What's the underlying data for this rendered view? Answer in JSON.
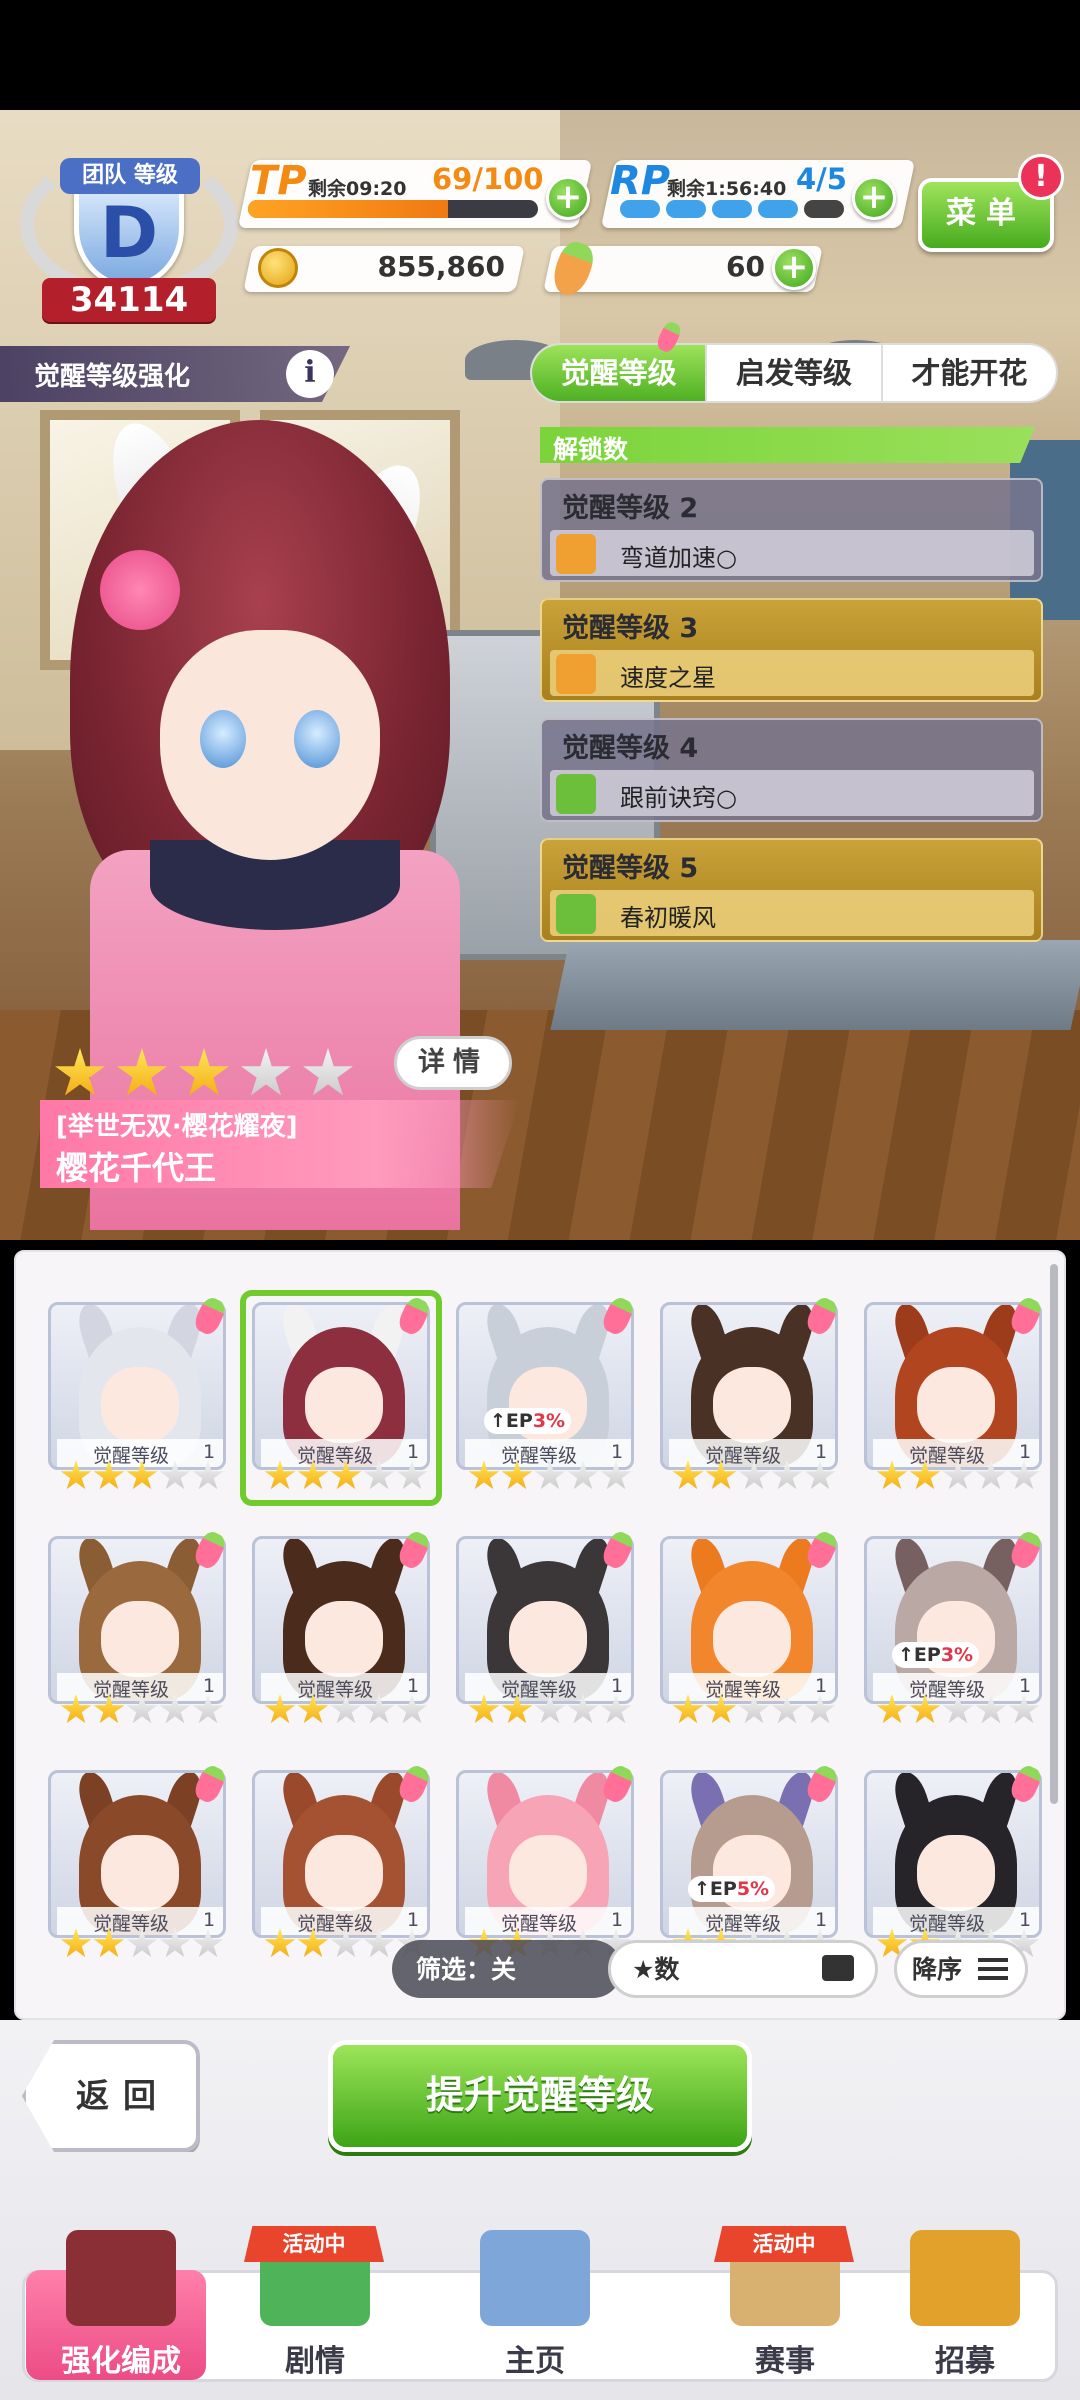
{
  "hud": {
    "team_rank_title": "团队 等级",
    "team_rank_letter": "D",
    "team_score": "34114",
    "tp": {
      "label": "TP",
      "remain": "剩余09:20",
      "value": "69/100",
      "fill": 0.69
    },
    "rp": {
      "label": "RP",
      "remain": "剩余1:56:40",
      "value": "4/5",
      "filled_pips": 4,
      "total_pips": 5
    },
    "money": "855,860",
    "carrots": "60",
    "plus": "+",
    "menu_label": "菜单",
    "menu_alert": "!"
  },
  "section": {
    "title": "觉醒等级强化",
    "info": "i"
  },
  "tabs": [
    {
      "label": "觉醒等级",
      "active": true
    },
    {
      "label": "启发等级",
      "active": false
    },
    {
      "label": "才能开花",
      "active": false
    }
  ],
  "unlock": {
    "header": "解锁数",
    "items": [
      {
        "level": "觉醒等级 2",
        "skill": "弯道加速○",
        "unlocked": false,
        "icon_color": "#f0a030"
      },
      {
        "level": "觉醒等级 3",
        "skill": "速度之星",
        "unlocked": true,
        "icon_color": "#f0a030"
      },
      {
        "level": "觉醒等级 4",
        "skill": "跟前诀窍○",
        "unlocked": false,
        "icon_color": "#6bbf3a"
      },
      {
        "level": "觉醒等级 5",
        "skill": "春初暖风",
        "unlocked": true,
        "icon_color": "#6bbf3a"
      }
    ]
  },
  "character": {
    "stars": 3,
    "max_stars": 5,
    "detail_label": "详情",
    "title": "[举世无双·樱花耀夜]",
    "name": "樱花千代王"
  },
  "roster": {
    "lv_label": "觉醒等级",
    "cards": [
      {
        "hair": "#e4e6ee",
        "ear": "#d3d6e0",
        "stars": 3,
        "lv": "1",
        "ep": "",
        "selected": false
      },
      {
        "hair": "#8d2f3f",
        "ear": "#f2f2f2",
        "stars": 3,
        "lv": "1",
        "ep": "",
        "selected": true
      },
      {
        "hair": "#c9cfd9",
        "ear": "#c9cfd9",
        "stars": 2,
        "lv": "1",
        "ep": "3%",
        "selected": false
      },
      {
        "hair": "#4a3126",
        "ear": "#4a3126",
        "stars": 2,
        "lv": "1",
        "ep": "",
        "selected": false
      },
      {
        "hair": "#b0451f",
        "ear": "#9c3c1b",
        "stars": 2,
        "lv": "1",
        "ep": "",
        "selected": false
      },
      {
        "hair": "#9a6a3e",
        "ear": "#8b5d34",
        "stars": 2,
        "lv": "1",
        "ep": "",
        "selected": false
      },
      {
        "hair": "#4a2b1c",
        "ear": "#4a2b1c",
        "stars": 2,
        "lv": "1",
        "ep": "",
        "selected": false
      },
      {
        "hair": "#3b3638",
        "ear": "#3b3638",
        "stars": 2,
        "lv": "1",
        "ep": "",
        "selected": false
      },
      {
        "hair": "#f2862c",
        "ear": "#ec7a1e",
        "stars": 2,
        "lv": "1",
        "ep": "",
        "selected": false
      },
      {
        "hair": "#b9a8a4",
        "ear": "#776060",
        "stars": 2,
        "lv": "1",
        "ep": "3%",
        "selected": false
      },
      {
        "hair": "#8a4a2a",
        "ear": "#7c4124",
        "stars": 2,
        "lv": "1",
        "ep": "",
        "selected": false
      },
      {
        "hair": "#a45232",
        "ear": "#9a4a2a",
        "stars": 2,
        "lv": "1",
        "ep": "",
        "selected": false
      },
      {
        "hair": "#f7a4b6",
        "ear": "#f08aa2",
        "stars": 2,
        "lv": "1",
        "ep": "",
        "selected": false
      },
      {
        "hair": "#b59c8e",
        "ear": "#7a6fb0",
        "stars": 2,
        "lv": "1",
        "ep": "5%",
        "selected": false
      },
      {
        "hair": "#262428",
        "ear": "#262428",
        "stars": 2,
        "lv": "1",
        "ep": "",
        "selected": false
      }
    ],
    "ep_prefix": "↑EP"
  },
  "filter": {
    "filter_label": "筛选：关",
    "sort_label": "★数",
    "order_label": "降序"
  },
  "actions": {
    "back": "返回",
    "upgrade": "提升觉醒等级"
  },
  "nav": {
    "items": [
      {
        "label": "强化编成",
        "active": true,
        "badge": "",
        "icon_color": "#8a2f35"
      },
      {
        "label": "剧情",
        "active": false,
        "badge": "活动中",
        "icon_color": "#4fb35a"
      },
      {
        "label": "主页",
        "active": false,
        "badge": "",
        "icon_color": "#7ea6d8"
      },
      {
        "label": "赛事",
        "active": false,
        "badge": "活动中",
        "icon_color": "#d8b070"
      },
      {
        "label": "招募",
        "active": false,
        "badge": "",
        "icon_color": "#e2a12a"
      }
    ]
  }
}
